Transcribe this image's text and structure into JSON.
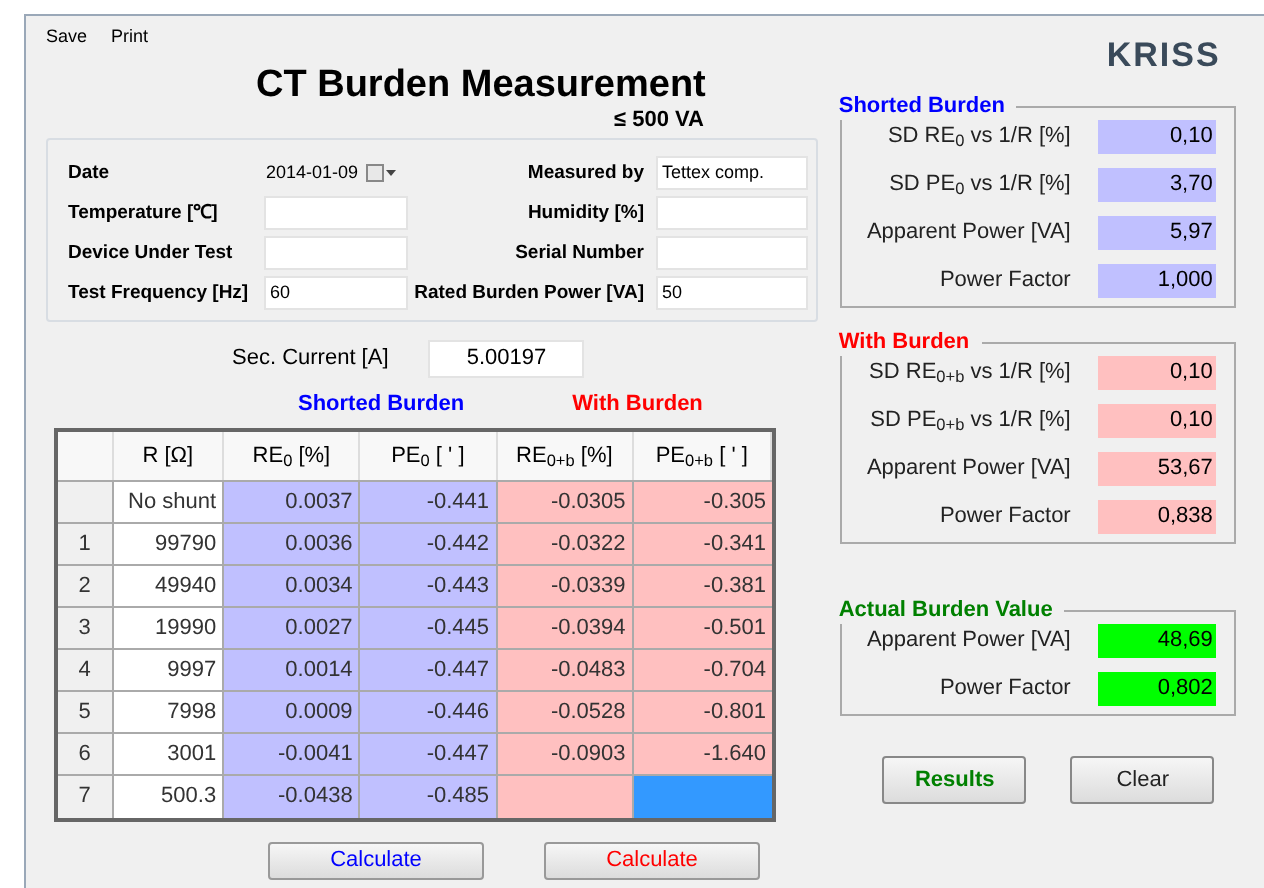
{
  "menu": [
    {
      "label": "Save"
    },
    {
      "label": "Print"
    }
  ],
  "logo": {
    "text": "KRISS"
  },
  "title": "CT Burden Measurement",
  "subtitle": "≤ 500 VA",
  "info_fields": [
    {
      "label": "Date",
      "value": "2014-01-09",
      "kind": "date"
    },
    {
      "label": "Measured by",
      "value": "Tettex comp.",
      "kind": "text"
    },
    {
      "label": "Temperature [℃]",
      "kind": "text"
    },
    {
      "label": "Humidity [%]",
      "kind": "text"
    },
    {
      "label": "Device Under Test",
      "kind": "text"
    },
    {
      "label": "Serial Number",
      "kind": "text"
    },
    {
      "label": "Test Frequency [Hz]",
      "value": "60",
      "kind": "text"
    },
    {
      "label": "Rated Burden Power [VA]",
      "value": "50",
      "kind": "text"
    }
  ],
  "sec_current": {
    "label": "Sec. Current [A]",
    "value": "5.00197"
  },
  "table": {
    "group_headers": [
      {
        "label": "Shorted Burden",
        "kind": "shorted"
      },
      {
        "label": "With Burden",
        "kind": "with"
      }
    ],
    "columns": [
      "R [Ω]",
      "RE$_{0}$ [%]",
      "PE$_{0}$ [ ' ]",
      "RE$_{0+b}$ [%]",
      "PE$_{0+b}$ [ ' ]"
    ],
    "rows": [
      {
        "r": "No shunt",
        "re0": "0.0037",
        "pe0": "-0.441",
        "reb": "-0.0305",
        "peb": "-0.305",
        "peb_selected": false
      },
      {
        "index": "1",
        "r": "99790",
        "re0": "0.0036",
        "pe0": "-0.442",
        "reb": "-0.0322",
        "peb": "-0.341",
        "peb_selected": false
      },
      {
        "index": "2",
        "r": "49940",
        "re0": "0.0034",
        "pe0": "-0.443",
        "reb": "-0.0339",
        "peb": "-0.381",
        "peb_selected": false
      },
      {
        "index": "3",
        "r": "19990",
        "re0": "0.0027",
        "pe0": "-0.445",
        "reb": "-0.0394",
        "peb": "-0.501",
        "peb_selected": false
      },
      {
        "index": "4",
        "r": "9997",
        "re0": "0.0014",
        "pe0": "-0.447",
        "reb": "-0.0483",
        "peb": "-0.704",
        "peb_selected": false
      },
      {
        "index": "5",
        "r": "7998",
        "re0": "0.0009",
        "pe0": "-0.446",
        "reb": "-0.0528",
        "peb": "-0.801",
        "peb_selected": false
      },
      {
        "index": "6",
        "r": "3001",
        "re0": "-0.0041",
        "pe0": "-0.447",
        "reb": "-0.0903",
        "peb": "-1.640",
        "peb_selected": false
      },
      {
        "index": "7",
        "r": "500.3",
        "re0": "-0.0438",
        "pe0": "-0.485",
        "peb_selected": true
      }
    ]
  },
  "calculate_buttons": [
    {
      "label": "Calculate",
      "kind": "shorted"
    },
    {
      "label": "Calculate",
      "kind": "with"
    }
  ],
  "groups": [
    {
      "title": "Shorted Burden",
      "kind": "shorted",
      "rows": [
        {
          "label": "SD RE$_{0}$  vs 1/R [%]",
          "value": "0,10"
        },
        {
          "label": "SD PE$_{0}$  vs 1/R [%]",
          "value": "3,70"
        },
        {
          "label": "Apparent Power [VA]",
          "value": "5,97"
        },
        {
          "label": "Power Factor",
          "value": "1,000"
        }
      ]
    },
    {
      "title": "With Burden",
      "kind": "with",
      "rows": [
        {
          "label": "SD RE$_{0+b}$  vs 1/R [%]",
          "value": "0,10"
        },
        {
          "label": "SD PE$_{0+b}$  vs 1/R [%]",
          "value": "0,10"
        },
        {
          "label": "Apparent Power [VA]",
          "value": "53,67"
        },
        {
          "label": "Power Factor",
          "value": "0,838"
        }
      ]
    },
    {
      "title": "Actual Burden Value",
      "kind": "actual",
      "rows": [
        {
          "label": "Apparent Power [VA]",
          "value": "48,69"
        },
        {
          "label": "Power Factor",
          "value": "0,802"
        }
      ]
    }
  ],
  "buttons": [
    {
      "label": "Results",
      "kind": "results"
    },
    {
      "label": "Clear",
      "kind": "clear"
    }
  ]
}
